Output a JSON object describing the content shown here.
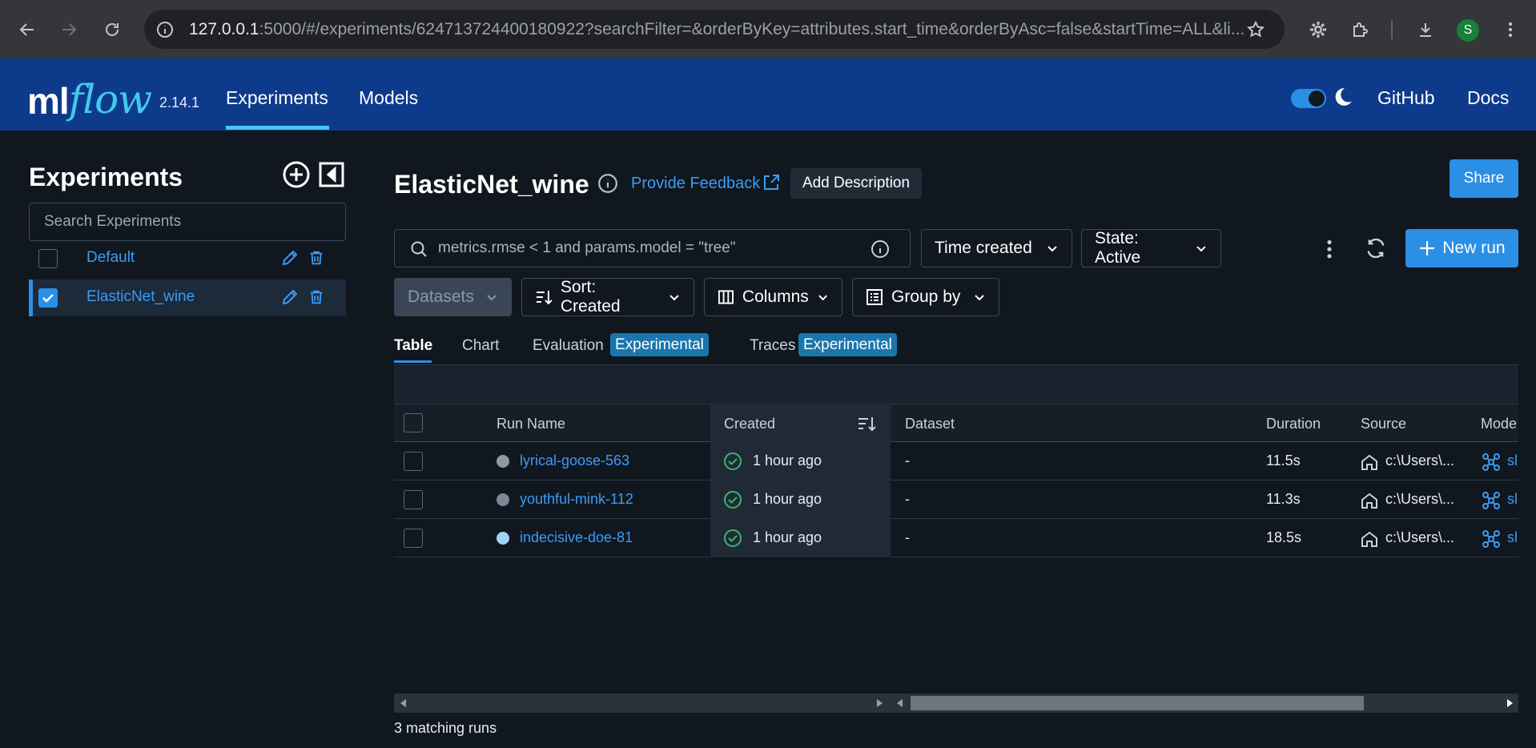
{
  "browser": {
    "url_host": "127.0.0.1",
    "url_rest": ":5000/#/experiments/624713724400180922?searchFilter=&orderByKey=attributes.start_time&orderByAsc=false&startTime=ALL&li...",
    "avatar_letter": "S"
  },
  "header": {
    "logo_ml": "ml",
    "logo_flow": "flow",
    "version": "2.14.1",
    "nav": [
      "Experiments",
      "Models"
    ],
    "active_nav": "Experiments",
    "github": "GitHub",
    "docs": "Docs",
    "dark_mode": true
  },
  "sidebar": {
    "title": "Experiments",
    "search_placeholder": "Search Experiments",
    "experiments": [
      {
        "name": "Default",
        "checked": false
      },
      {
        "name": "ElasticNet_wine",
        "checked": true
      }
    ]
  },
  "main": {
    "experiment_title": "ElasticNet_wine",
    "feedback_label": "Provide Feedback",
    "add_description_label": "Add Description",
    "share_label": "Share",
    "search_placeholder": "metrics.rmse < 1 and params.model = \"tree\"",
    "time_filter": "Time created",
    "state_filter": "State: Active",
    "new_run_label": "New run",
    "datasets_label": "Datasets",
    "sort_label": "Sort: Created",
    "columns_label": "Columns",
    "group_by_label": "Group by",
    "tabs": {
      "table": "Table",
      "chart": "Chart",
      "evaluation": "Evaluation",
      "evaluation_badge": "Experimental",
      "traces": "Traces",
      "traces_badge": "Experimental"
    },
    "table": {
      "headers": {
        "run_name": "Run Name",
        "created": "Created",
        "dataset": "Dataset",
        "duration": "Duration",
        "source": "Source",
        "models": "Mode"
      },
      "rows": [
        {
          "name": "lyrical-goose-563",
          "created": "1 hour ago",
          "dataset": "-",
          "duration": "11.5s",
          "source": "c:\\Users\\...",
          "model": "sl",
          "color": "#8d98a5"
        },
        {
          "name": "youthful-mink-112",
          "created": "1 hour ago",
          "dataset": "-",
          "duration": "11.3s",
          "source": "c:\\Users\\...",
          "model": "sl",
          "color": "#7b8794"
        },
        {
          "name": "indecisive-doe-81",
          "created": "1 hour ago",
          "dataset": "-",
          "duration": "18.5s",
          "source": "c:\\Users\\...",
          "model": "sl",
          "color": "#9fd3f7"
        }
      ]
    },
    "matching_runs": "3 matching runs"
  }
}
